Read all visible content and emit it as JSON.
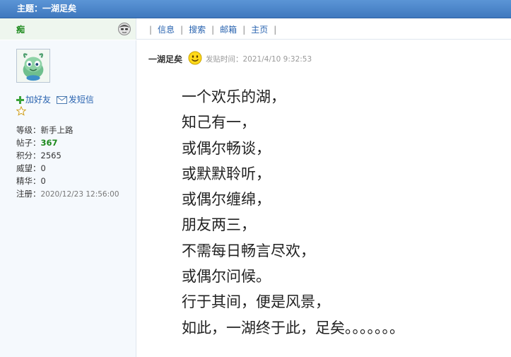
{
  "topic_bar": {
    "title": "主题：一湖足矣"
  },
  "userbar": {
    "username": "痴",
    "actions": [
      "信息",
      "搜索",
      "邮箱",
      "主页"
    ]
  },
  "profile": {
    "add_friend": "加好友",
    "send_message": "发短信",
    "level_label": "等级：",
    "level_value": "新手上路",
    "posts_label": "帖子：",
    "posts_value": "367",
    "points_label": "积分：",
    "points_value": "2565",
    "prestige_label": "威望：",
    "prestige_value": "0",
    "elite_label": "精华：",
    "elite_value": "0",
    "register_label": "注册：",
    "register_value": "2020/12/23 12:56:00"
  },
  "post": {
    "author": "一湖足矣",
    "time": "发贴时间：2021/4/10 9:32:53",
    "lines": [
      "一个欢乐的湖，",
      "知己有一，",
      "或偶尔畅谈，",
      "或默默聆听，",
      "或偶尔缠绵，",
      "朋友两三，",
      "不需每日畅言尽欢，",
      "或偶尔问候。",
      "行于其间，便是风景，",
      "如此，一湖终于此，足矣。。。。。。。"
    ]
  },
  "colors": {
    "title_bar": "#4a86c8",
    "username": "#1d8a1d",
    "link": "#2a64b0"
  },
  "icons": {
    "online": "user-status-icon",
    "add_friend": "plus-icon",
    "send_message": "envelope-icon",
    "rank": "star-icon",
    "mood": "smiley-icon"
  }
}
